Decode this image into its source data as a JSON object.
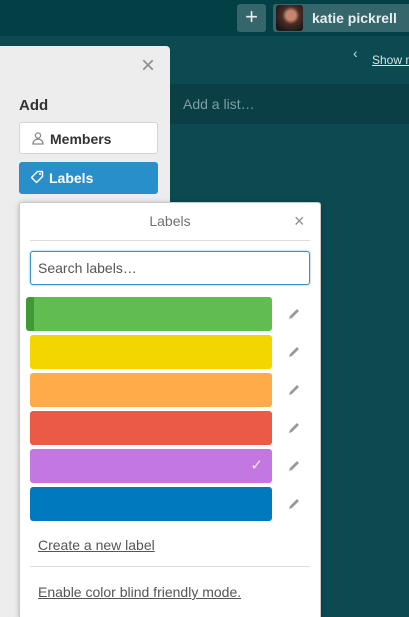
{
  "header": {
    "plus_icon": "plus-icon",
    "user_name": "katie pickrell"
  },
  "board": {
    "show_menu_label": "Show m",
    "add_list_placeholder": "Add a list…"
  },
  "side_panel": {
    "heading": "Add",
    "buttons": [
      {
        "label": "Members",
        "icon": "person-icon"
      },
      {
        "label": "Labels",
        "icon": "tag-icon"
      }
    ]
  },
  "labels_popover": {
    "title": "Labels",
    "search_placeholder": "Search labels…",
    "labels": [
      {
        "color": "#61bd4f",
        "selected": false
      },
      {
        "color": "#f2d600",
        "selected": false
      },
      {
        "color": "#ffab4a",
        "selected": false
      },
      {
        "color": "#eb5a46",
        "selected": false
      },
      {
        "color": "#c377e0",
        "selected": true
      },
      {
        "color": "#0079bf",
        "selected": false
      }
    ],
    "create_label_link": "Create a new label",
    "color_blind_link": "Enable color blind friendly mode."
  },
  "colors": {
    "board_bg": "#0b4a51",
    "header_bg": "#034046",
    "primary_button": "#298fca"
  }
}
